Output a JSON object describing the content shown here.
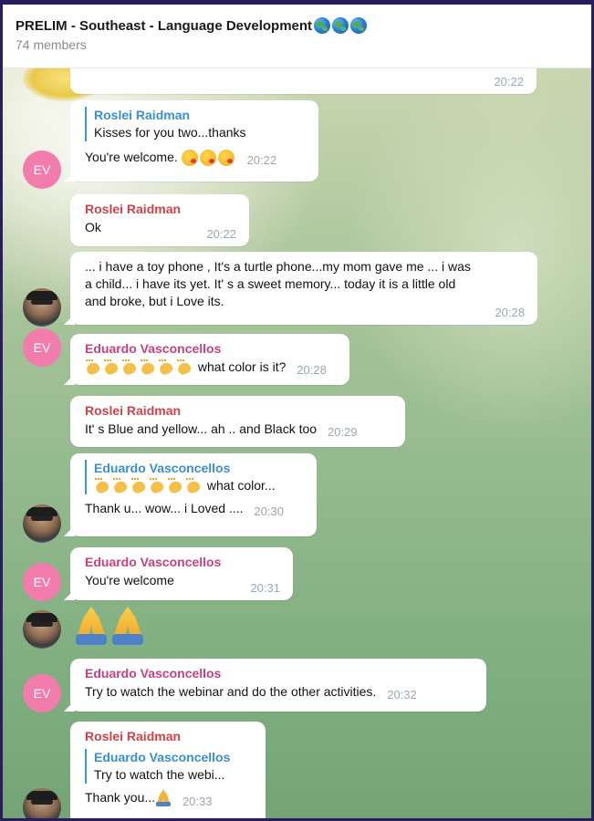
{
  "chat": {
    "title": "PRELIM - Southeast - Language Development",
    "title_emoji": [
      "globe-europe-africa",
      "globe-americas",
      "globe-asia-australia"
    ],
    "members": "74 members"
  },
  "messages": [
    {
      "id": "m0",
      "time": "20:22"
    },
    {
      "id": "m1",
      "sender": "",
      "reply_name": "Roslei Raidman",
      "reply_text": "Kisses for you two...thanks",
      "text": "You're welcome.",
      "emoji": [
        "face-blowing-kiss",
        "face-blowing-kiss",
        "face-blowing-kiss"
      ],
      "time": "20:22",
      "avatar": "EV"
    },
    {
      "id": "m2",
      "sender": "Roslei Raidman",
      "text": "Ok",
      "time": "20:22"
    },
    {
      "id": "m3",
      "text_lines": [
        "... i have a toy phone , It's a turtle phone...my mom gave me ... i was",
        "a child... i have its yet. It' s a sweet memory... today it is a little old",
        "and broke, but i Love its."
      ],
      "time": "20:28"
    },
    {
      "id": "m4",
      "sender": "Eduardo Vasconcellos",
      "text": "what color is it?",
      "emoji": [
        "clapping-hands",
        "clapping-hands",
        "clapping-hands",
        "clapping-hands",
        "clapping-hands",
        "clapping-hands"
      ],
      "time": "20:28",
      "avatar": "EV"
    },
    {
      "id": "m5",
      "sender": "Roslei Raidman",
      "text": "It' s Blue and yellow... ah .. and Black too",
      "time": "20:29"
    },
    {
      "id": "m6",
      "reply_name": "Eduardo Vasconcellos",
      "reply_text": "what color...",
      "reply_emoji": [
        "clapping-hands",
        "clapping-hands",
        "clapping-hands",
        "clapping-hands",
        "clapping-hands",
        "clapping-hands"
      ],
      "text": "Thank u... wow... i Loved ....",
      "time": "20:30"
    },
    {
      "id": "m7",
      "sender": "Eduardo Vasconcellos",
      "text": "You're welcome",
      "time": "20:31",
      "avatar": "EV"
    },
    {
      "id": "m8",
      "emoji": [
        "folded-hands",
        "folded-hands"
      ]
    },
    {
      "id": "m9",
      "sender": "Eduardo Vasconcellos",
      "text": "Try to watch the webinar and do the other activities.",
      "time": "20:32",
      "avatar": "EV"
    },
    {
      "id": "m10",
      "sender": "Roslei Raidman",
      "reply_name": "Eduardo Vasconcellos",
      "reply_text": "Try to watch the webi...",
      "text": "Thank you...",
      "emoji": [
        "folded-hands"
      ],
      "time": "20:33"
    }
  ],
  "colors": {
    "red_sender": "#c8454b",
    "pink_sender": "#c8417a",
    "reply_accent": "#3a9ad9",
    "ev_avatar": "#f27cab",
    "time": "#9aa7b3"
  }
}
